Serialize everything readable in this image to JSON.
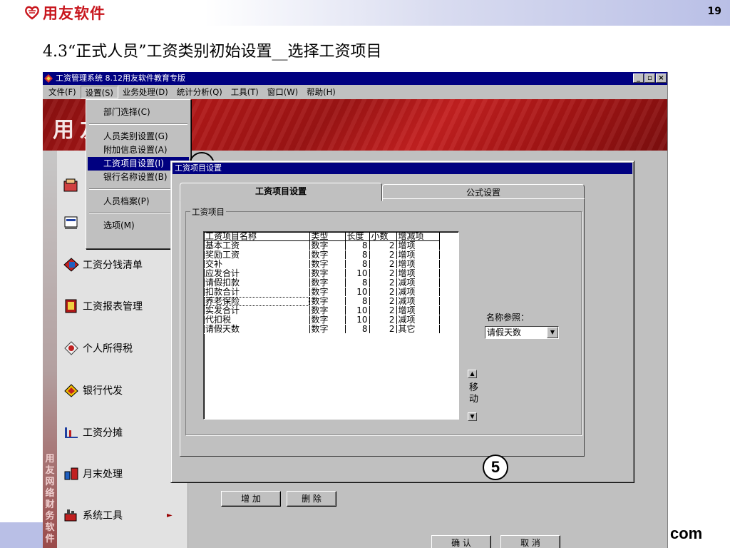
{
  "slide": {
    "logo_text": "用友软件",
    "page_number": "19",
    "title": "4.3“正式人员”工资类别初始设置__选择工资项目",
    "footer_text": "com"
  },
  "window": {
    "title": "工资管理系统 8.12用友软件教育专版",
    "buttons": [
      "_",
      "▫",
      "×"
    ]
  },
  "menubar": [
    "文件(F)",
    "设置(S)",
    "业务处理(D)",
    "统计分析(Q)",
    "工具(T)",
    "窗口(W)",
    "帮助(H)"
  ],
  "banner_text": "用友软件",
  "dropdown": [
    {
      "label": "部门选择(C)"
    },
    {
      "label": "人员类别设置(G)"
    },
    {
      "label": "附加信息设置(A)"
    },
    {
      "label": "工资项目设置(I)"
    },
    {
      "label": "银行名称设置(B)"
    },
    {
      "label": "人员档案(P)"
    },
    {
      "label": "选项(M)"
    }
  ],
  "nav": [
    {
      "label": "工资分钱清单",
      "icon": "payroll-slip-icon"
    },
    {
      "label": "工资报表管理",
      "icon": "report-book-icon"
    },
    {
      "label": "个人所得税",
      "icon": "tax-icon"
    },
    {
      "label": "银行代发",
      "icon": "bank-icon"
    },
    {
      "label": "工资分摊",
      "icon": "allocation-icon"
    },
    {
      "label": "月末处理",
      "icon": "month-end-icon"
    },
    {
      "label": "系统工具",
      "icon": "system-tools-icon"
    }
  ],
  "side_strip_text": "用友网络财务软件",
  "dialog": {
    "title": "工资项目设置",
    "tabs": [
      "工资项目设置",
      "公式设置"
    ],
    "group_label": "工资项目",
    "columns": [
      "工资项目名称",
      "类型",
      "长度",
      "小数",
      "增减项"
    ],
    "rows": [
      [
        "基本工资",
        "数字",
        "8",
        "2",
        "增项"
      ],
      [
        "奖励工资",
        "数字",
        "8",
        "2",
        "增项"
      ],
      [
        "交补",
        "数字",
        "8",
        "2",
        "增项"
      ],
      [
        "应发合计",
        "数字",
        "10",
        "2",
        "增项"
      ],
      [
        "请假扣款",
        "数字",
        "8",
        "2",
        "减项"
      ],
      [
        "扣款合计",
        "数字",
        "10",
        "2",
        "减项"
      ],
      [
        "养老保险",
        "数字",
        "8",
        "2",
        "减项"
      ],
      [
        "实发合计",
        "数字",
        "10",
        "2",
        "增项"
      ],
      [
        "代扣税",
        "数字",
        "10",
        "2",
        "减项"
      ],
      [
        "请假天数",
        "数字",
        "8",
        "2",
        "其它"
      ]
    ],
    "name_ref_label": "名称参照：",
    "name_ref_value": "请假天数",
    "move_label": "移动",
    "add_button": "增 加",
    "delete_button": "删 除",
    "ok_button": "确 认",
    "cancel_button": "取 消"
  },
  "callout_number": "5",
  "colors": {
    "title_bar": "#000080",
    "logo_red": "#c8161d",
    "banner_red": "#b01818",
    "face": "#c0c0c0"
  }
}
